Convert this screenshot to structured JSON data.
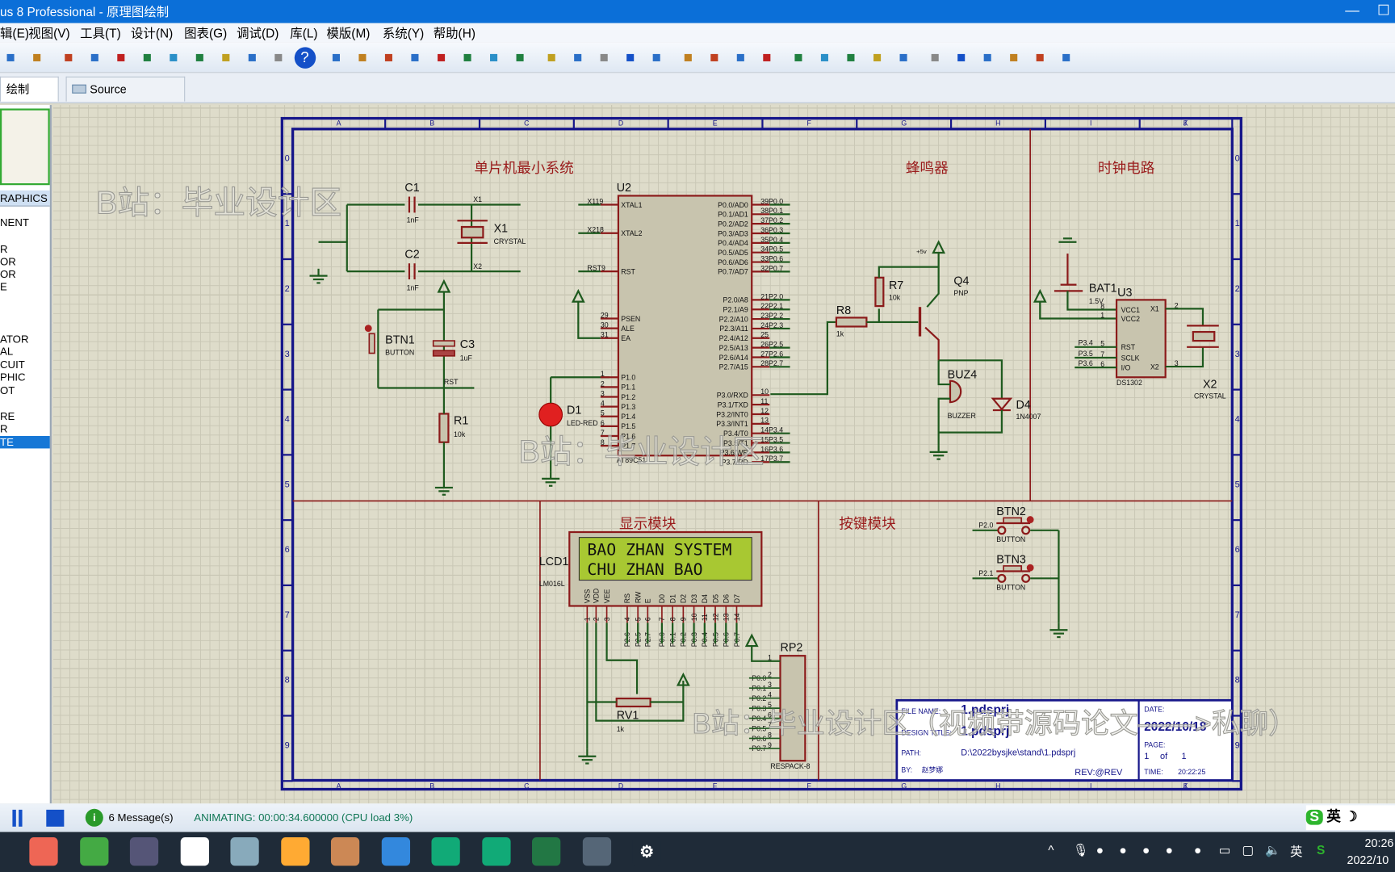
{
  "window": {
    "title": "us 8 Professional - 原理图绘制",
    "minimize": "—",
    "maximize": "☐"
  },
  "menu": [
    "辑(E)",
    "视图(V)",
    "工具(T)",
    "设计(N)",
    "图表(G)",
    "调试(D)",
    "库(L)",
    "模版(M)",
    "系统(Y)",
    "帮助(H)"
  ],
  "toolbar_icons": [
    "save-icon",
    "exit-icon",
    "home-icon",
    "schematic-icon",
    "pcb-icon",
    "3d-icon",
    "gerber-icon",
    "bom-icon",
    "bill-icon",
    "source-code-icon",
    "notes-icon",
    "help-icon",
    "refresh-icon",
    "grid-icon",
    "origin-icon",
    "pan-icon",
    "zoom-in-icon",
    "zoom-out-icon",
    "zoom-all-icon",
    "zoom-area-icon",
    "undo-icon",
    "redo-icon",
    "cut-icon",
    "copy-icon",
    "paste-icon",
    "block-copy-icon",
    "block-move-icon",
    "block-rotate-icon",
    "block-delete-icon",
    "pick-icon",
    "make-device-icon",
    "package-icon",
    "decompose-icon",
    "wire-autorouter-icon",
    "search-icon",
    "property-icon",
    "new-sheet-icon",
    "remove-sheet-icon",
    "exit-parent-icon",
    "netlist-icon"
  ],
  "tabs": [
    {
      "label": "绘制",
      "active": true
    },
    {
      "label": "Source Code",
      "active": false
    }
  ],
  "left_panel": {
    "header": "RAPHICS",
    "items": [
      "NENT",
      "",
      "R",
      "OR",
      "OR",
      "E",
      "",
      "",
      "ATOR",
      "AL",
      "CUIT",
      "PHIC",
      "OT",
      "",
      "RE",
      "R",
      "TE"
    ],
    "selected": "TE"
  },
  "schematic": {
    "columns": [
      "A",
      "B",
      "C",
      "D",
      "E",
      "F",
      "G",
      "H",
      "I",
      "J",
      "K"
    ],
    "rows": [
      "0",
      "1",
      "2",
      "3",
      "4",
      "5",
      "6",
      "7",
      "8",
      "9"
    ],
    "sections": [
      "单片机最小系统",
      "蜂鸣器",
      "时钟电路",
      "显示模块",
      "按键模块"
    ],
    "labels": {
      "c1": "C1",
      "c1v": "1nF",
      "c2": "C2",
      "c2v": "1nF",
      "x1": "X1",
      "x1v": "CRYSTAL",
      "x1n": "X1",
      "x2n": "X2",
      "btn1": "BTN1",
      "btn1v": "BUTTON",
      "c3": "C3",
      "c3v": "1uF",
      "rst": "RST",
      "r1": "R1",
      "r1v": "10k",
      "d1": "D1",
      "d1v": "LED-RED",
      "u2": "U2",
      "u2v": "AT89C51",
      "r8": "R8",
      "r8v": "1k",
      "r7": "R7",
      "r7v": "10k",
      "q4": "Q4",
      "q4v": "PNP",
      "vcc": "+5v",
      "buz": "BUZ4",
      "buzv": "BUZZER",
      "d4": "D4",
      "d4v": "1N4007",
      "bat": "BAT1",
      "batv": "1.5V",
      "u3": "U3",
      "u3v": "DS1302",
      "x2": "X2",
      "x2v": "CRYSTAL",
      "lcd": "LCD1",
      "lcdv": "LM016L",
      "lcd_line1": "BAO ZHAN SYSTEM",
      "lcd_line2": "CHU ZHAN BAO",
      "rv1": "RV1",
      "rv1v": "1k",
      "rp2": "RP2",
      "rp2v": "RESPACK-8",
      "btn2": "BTN2",
      "btn2v": "BUTTON",
      "btn2n": "P2.0",
      "btn3": "BTN3",
      "btn3v": "BUTTON",
      "btn3n": "P2.1"
    },
    "u2_left": [
      [
        "X1",
        "19",
        "XTAL1"
      ],
      [
        "X2",
        "18",
        "XTAL2"
      ],
      [
        "RST",
        "9",
        "RST"
      ],
      [
        "",
        "29",
        "PSEN"
      ],
      [
        "",
        "30",
        "ALE"
      ],
      [
        "",
        "31",
        "EA"
      ],
      [
        "",
        "1",
        "P1.0"
      ],
      [
        "",
        "2",
        "P1.1"
      ],
      [
        "",
        "3",
        "P1.2"
      ],
      [
        "",
        "4",
        "P1.3"
      ],
      [
        "",
        "5",
        "P1.4"
      ],
      [
        "",
        "6",
        "P1.5"
      ],
      [
        "",
        "7",
        "P1.6"
      ],
      [
        "",
        "8",
        "P1.7"
      ]
    ],
    "u2_right": [
      [
        "P0.0/AD0",
        "39",
        "P0.0"
      ],
      [
        "P0.1/AD1",
        "38",
        "P0.1"
      ],
      [
        "P0.2/AD2",
        "37",
        "P0.2"
      ],
      [
        "P0.3/AD3",
        "36",
        "P0.3"
      ],
      [
        "P0.4/AD4",
        "35",
        "P0.4"
      ],
      [
        "P0.5/AD5",
        "34",
        "P0.5"
      ],
      [
        "P0.6/AD6",
        "33",
        "P0.6"
      ],
      [
        "P0.7/AD7",
        "32",
        "P0.7"
      ],
      [
        "P2.0/A8",
        "21",
        "P2.0"
      ],
      [
        "P2.1/A9",
        "22",
        "P2.1"
      ],
      [
        "P2.2/A10",
        "23",
        "P2.2"
      ],
      [
        "P2.3/A11",
        "24",
        "P2.3"
      ],
      [
        "P2.4/A12",
        "25",
        ""
      ],
      [
        "P2.5/A13",
        "26",
        "P2.5"
      ],
      [
        "P2.6/A14",
        "27",
        "P2.6"
      ],
      [
        "P2.7/A15",
        "28",
        "P2.7"
      ],
      [
        "P3.0/RXD",
        "10",
        ""
      ],
      [
        "P3.1/TXD",
        "11",
        ""
      ],
      [
        "P3.2/INT0",
        "12",
        ""
      ],
      [
        "P3.3/INT1",
        "13",
        ""
      ],
      [
        "P3.4/T0",
        "14",
        "P3.4"
      ],
      [
        "P3.5/T1",
        "15",
        "P3.5"
      ],
      [
        "P3.6/WR",
        "16",
        "P3.6"
      ],
      [
        "P3.7/RD",
        "17",
        "P3.7"
      ]
    ],
    "u3_left": [
      [
        "8",
        "VCC1",
        ""
      ],
      [
        "1",
        "VCC2",
        ""
      ],
      [
        "5",
        "RST",
        "P3.4"
      ],
      [
        "7",
        "SCLK",
        "P3.5"
      ],
      [
        "6",
        "I/O",
        "P3.6"
      ]
    ],
    "u3_right": [
      [
        "2",
        "X1"
      ],
      [
        "3",
        "X2"
      ]
    ],
    "lcd_pins": [
      [
        "VSS",
        "1",
        ""
      ],
      [
        "VDD",
        "2",
        ""
      ],
      [
        "VEE",
        "3",
        ""
      ],
      [
        "RS",
        "4",
        "P2.6"
      ],
      [
        "RW",
        "5",
        "P2.5"
      ],
      [
        "E",
        "6",
        "P2.7"
      ],
      [
        "D0",
        "7",
        "P0.0"
      ],
      [
        "D1",
        "8",
        "P0.1"
      ],
      [
        "D2",
        "9",
        "P0.2"
      ],
      [
        "D3",
        "10",
        "P0.3"
      ],
      [
        "D4",
        "11",
        "P0.4"
      ],
      [
        "D5",
        "12",
        "P0.5"
      ],
      [
        "D6",
        "13",
        "P0.6"
      ],
      [
        "D7",
        "14",
        "P0.7"
      ]
    ],
    "rp2_pins": [
      [
        "1",
        ""
      ],
      [
        "2",
        "P0.0"
      ],
      [
        "3",
        "P0.1"
      ],
      [
        "4",
        "P0.2"
      ],
      [
        "5",
        "P0.3"
      ],
      [
        "6",
        "P0.4"
      ],
      [
        "7",
        "P0.5"
      ],
      [
        "8",
        "P0.6"
      ],
      [
        "9",
        "P0.7"
      ]
    ],
    "title_block": {
      "file_name_label": "FILE NAME:",
      "file_name": "1.pdsprj",
      "design_title_label": "DESIGN TITLE:",
      "design_title": "1.pdsprj",
      "path_label": "PATH:",
      "path": "D:\\2022bysjke\\stand\\1.pdsprj",
      "by_label": "BY:",
      "by": "赵梦娜",
      "rev": "REV:@REV",
      "date_label": "DATE:",
      "date": "2022/10/18",
      "page_label": "PAGE:",
      "page": "1",
      "of": "of",
      "pages": "1",
      "time_label": "TIME:",
      "time": "20:22:25"
    },
    "watermarks": [
      "B站：毕业设计区",
      "B站：毕业设计区",
      "B站：毕业设计区（视频带源码论文——>私聊）"
    ]
  },
  "status": {
    "messages": "6 Message(s)",
    "animating": "ANIMATING: 00:00:34.600000 (CPU load 3%)",
    "ime": "英"
  },
  "taskbar": {
    "apps": [
      "chrome-icon",
      "ie-icon",
      "notepad-icon",
      "baidu-netdisk-icon",
      "glass-icon",
      "folder-icon",
      "proteus-isis-icon",
      "mail-icon",
      "app-p-icon",
      "app-ni-icon",
      "visio-icon",
      "proteus-icon",
      "settings-icon"
    ],
    "time": "20:26",
    "date": "2022/10",
    "ime": "英"
  },
  "colors": {
    "accent": "#0b6fd8",
    "wire": "#1e5a1e",
    "component": "#8b1a1a",
    "body": "#c8c4ae",
    "border": "#16168a",
    "lcd": "#a8c832"
  }
}
